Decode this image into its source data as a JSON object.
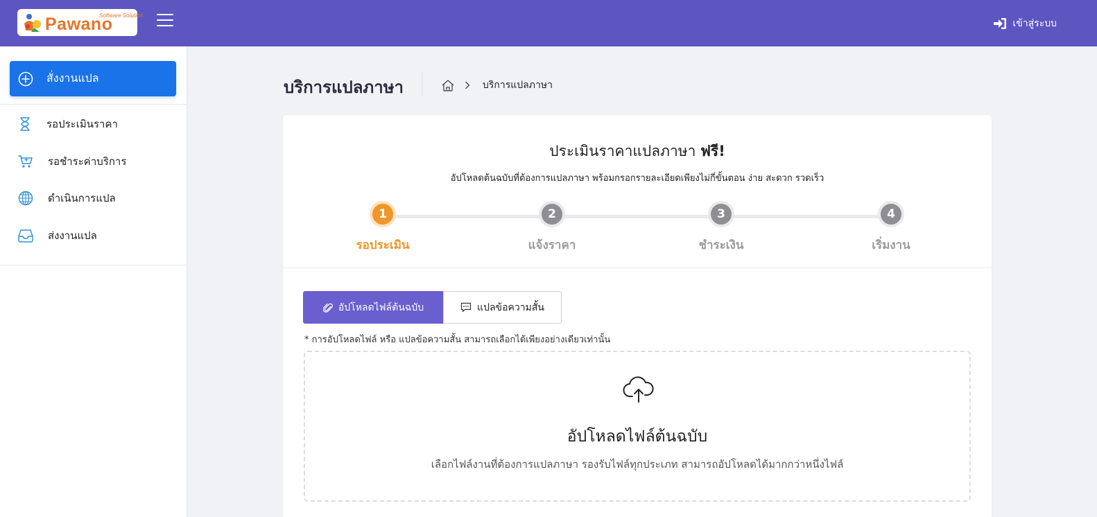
{
  "header": {
    "logo_tagline": "Software Solution",
    "logo_word": "Pawano",
    "login_label": "เข้าสู่ระบบ"
  },
  "sidebar": {
    "order_button": "สั่งงานแปล",
    "items": [
      {
        "label": "รอประเมินราคา",
        "icon": "hourglass-icon"
      },
      {
        "label": "รอชำระค่าบริการ",
        "icon": "cart-icon"
      },
      {
        "label": "ดำเนินการแปล",
        "icon": "globe-icon"
      },
      {
        "label": "ส่งงานแปล",
        "icon": "inbox-icon"
      }
    ]
  },
  "page": {
    "title": "บริการแปลภาษา",
    "breadcrumb_current": "บริการแปลภาษา"
  },
  "card": {
    "title_main": "ประเมินราคาแปลภาษา ",
    "title_bold": "ฟรี!",
    "subtitle": "อัปโหลดต้นฉบับที่ต้องการแปลภาษา พร้อมกรอกรายละเอียดเพียงไม่กี่ขั้นตอน ง่าย สะดวก รวดเร็ว",
    "steps": [
      {
        "number": "1",
        "label": "รอประเมิน",
        "active": true
      },
      {
        "number": "2",
        "label": "แจ้งราคา",
        "active": false
      },
      {
        "number": "3",
        "label": "ชำระเงิน",
        "active": false
      },
      {
        "number": "4",
        "label": "เริ่มงาน",
        "active": false
      }
    ],
    "tabs": {
      "upload_label": "อัปโหลดไฟล์ต้นฉบับ",
      "text_label": "แปลข้อความสั้น"
    },
    "note": "* การอัปโหลดไฟล์ หรือ แปลข้อความสั้น สามารถเลือกได้เพียงอย่างเดียวเท่านั้น",
    "dropzone": {
      "title": "อัปโหลดไฟล์ต้นฉบับ",
      "subtitle": "เลือกไฟล์งานที่ต้องการแปลภาษา รองรับไฟล์ทุกประเภท สามารถอัปโหลดได้มากกว่าหนึ่งไฟล์"
    }
  },
  "colors": {
    "header_bg": "#5d56c1",
    "primary_blue": "#1a73e8",
    "active_step": "#f0962a",
    "tab_active": "#6a5fcf"
  }
}
